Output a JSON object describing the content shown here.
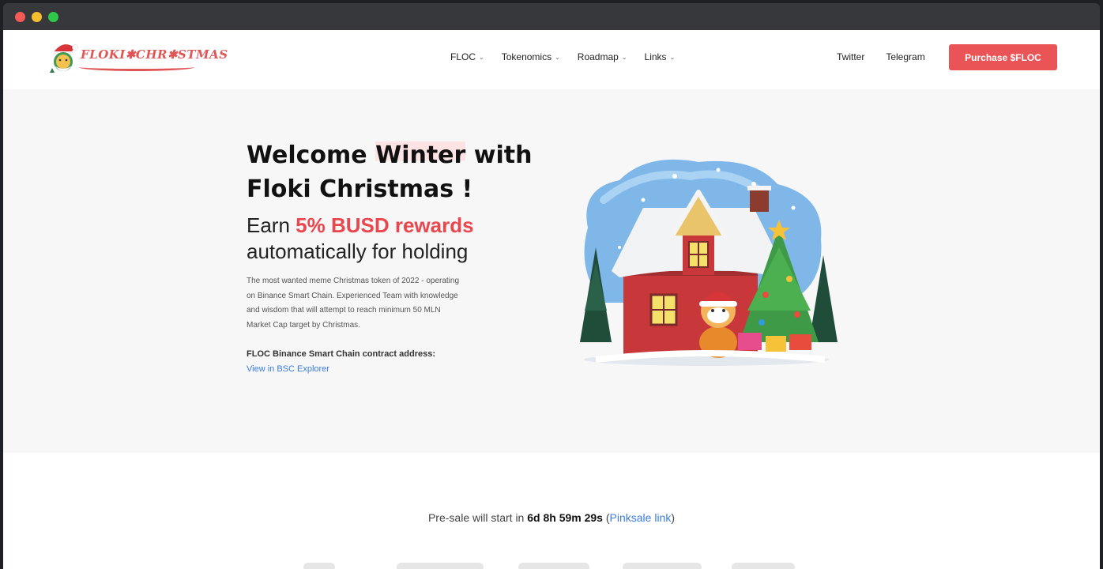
{
  "brand": {
    "logo_text": "FLOKI✱CHR✱STMAS",
    "accent_color": "#ea5456",
    "link_color": "#3b7de0"
  },
  "nav": {
    "items": [
      {
        "label": "FLOC",
        "icon": "chevron-down-icon"
      },
      {
        "label": "Tokenomics",
        "icon": "chevron-down-icon"
      },
      {
        "label": "Roadmap",
        "icon": "chevron-down-icon"
      },
      {
        "label": "Links",
        "icon": "chevron-down-icon"
      }
    ],
    "twitter": "Twitter",
    "telegram": "Telegram",
    "purchase": "Purchase $FLOC"
  },
  "hero": {
    "title_part1": "Welcome ",
    "title_highlight": "Winter",
    "title_part2": " with Floki Christmas !",
    "sub_prefix": "Earn ",
    "sub_accent": "5% BUSD rewards",
    "sub_suffix": "automatically for holding",
    "description": "The most wanted meme Christmas token of 2022 - operating on Binance Smart Chain. Experienced Team with knowledge and wisdom that will attempt to reach minimum 50 MLN Market Cap target by Christmas.",
    "contract_label": "FLOC Binance Smart Chain contract address:",
    "bsc_link": "View in BSC Explorer"
  },
  "countdown": {
    "prefix": "Pre-sale will start in ",
    "time": "6d 8h 59m 29s",
    "open_paren": " (",
    "link": "Pinksale link",
    "close_paren": ")"
  }
}
